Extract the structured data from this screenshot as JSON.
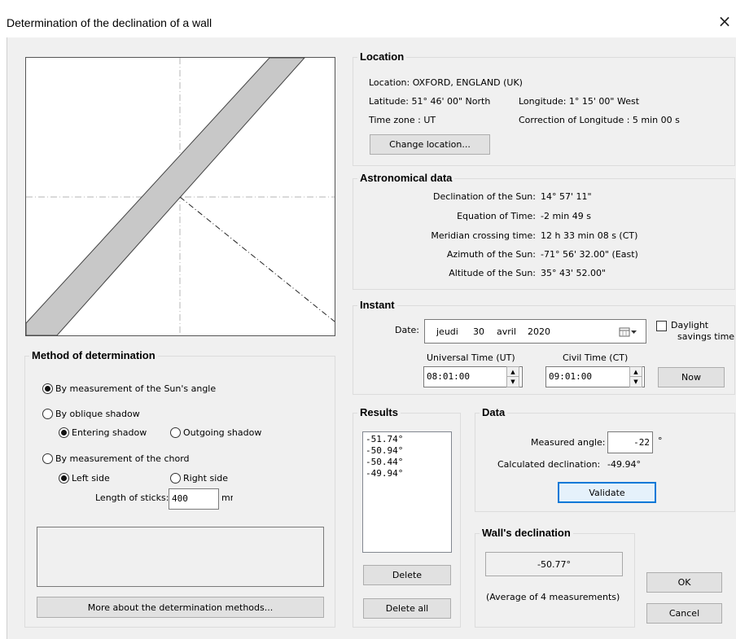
{
  "window": {
    "title": "Determination of the declination of a wall",
    "close_glyph": "×"
  },
  "location": {
    "heading": "Location",
    "location_line": "Location: OXFORD, ENGLAND (UK)",
    "latitude": "Latitude: 51° 46' 00\" North",
    "longitude": "Longitude: 1° 15' 00\" West",
    "time_zone": "Time zone : UT",
    "correction": "Correction of Longitude : 5 min 00 s",
    "change_button": "Change location..."
  },
  "astronomical": {
    "heading": "Astronomical data",
    "rows": [
      {
        "label": "Declination of the Sun:",
        "value": "14° 57' 11\""
      },
      {
        "label": "Equation of Time:",
        "value": "-2 min 49 s"
      },
      {
        "label": "Meridian crossing time:",
        "value": "12 h 33 min 08 s (CT)"
      },
      {
        "label": "Azimuth of the Sun:",
        "value": "-71° 56' 32.00\" (East)"
      },
      {
        "label": "Altitude of the Sun:",
        "value": "35° 43' 52.00\""
      }
    ]
  },
  "instant": {
    "heading": "Instant",
    "date_label": "Date:",
    "date_weekday": "jeudi",
    "date_day": "30",
    "date_month": "avril",
    "date_year": "2020",
    "daylight_label_1": "Daylight",
    "daylight_label_2": "savings time",
    "ut_label": "Universal Time (UT)",
    "ut_value": "08:01:00",
    "ct_label": "Civil Time (CT)",
    "ct_value": "09:01:00",
    "now_button": "Now"
  },
  "method": {
    "heading": "Method of determination",
    "opt_sun_angle": "By measurement of the Sun's angle",
    "opt_oblique": "By oblique shadow",
    "opt_entering": "Entering shadow",
    "opt_outgoing": "Outgoing shadow",
    "opt_chord": "By measurement of the chord",
    "opt_left": "Left side",
    "opt_right": "Right side",
    "sticks_label": "Length of sticks:",
    "sticks_value": "400",
    "sticks_unit": "mm",
    "more_button": "More about the determination methods..."
  },
  "results": {
    "heading": "Results",
    "items": [
      "-51.74°",
      "-50.94°",
      "-50.44°",
      "-49.94°"
    ],
    "delete_button": "Delete",
    "delete_all_button": "Delete all"
  },
  "data_panel": {
    "heading": "Data",
    "measured_label": "Measured angle:",
    "measured_value": "-22",
    "measured_unit": "°",
    "calc_label": "Calculated declination:",
    "calc_value": "-49.94°",
    "validate_button": "Validate"
  },
  "wall": {
    "heading": "Wall's declination",
    "value": "-50.77°",
    "note": "(Average of 4 measurements)"
  },
  "buttons": {
    "ok": "OK",
    "cancel": "Cancel"
  },
  "icons": {
    "calendar": "calendar-icon",
    "spin_up": "▲",
    "spin_down": "▼"
  }
}
